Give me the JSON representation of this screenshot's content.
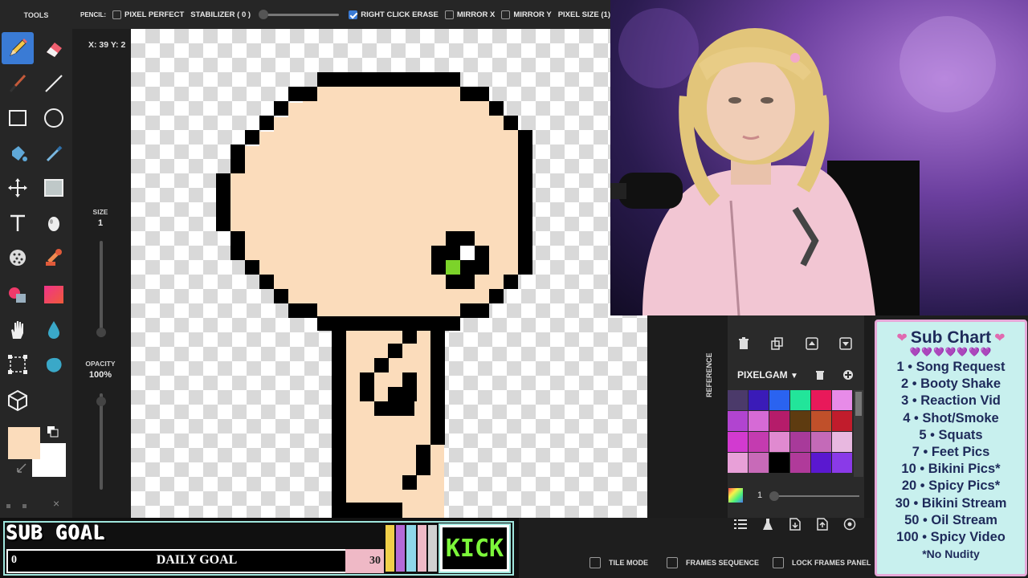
{
  "toolbar": {
    "tool_name": "PENCIL:",
    "pixel_perfect": "PIXEL PERFECT",
    "stabilizer": "STABILIZER ( 0 )",
    "right_click_erase": "RIGHT CLICK ERASE",
    "mirror_x": "MIRROR X",
    "mirror_y": "MIRROR Y",
    "pixel_size": "PIXEL SIZE (1)"
  },
  "tools": {
    "title": "TOOLS",
    "icons": [
      "pencil-icon",
      "eraser-icon",
      "brush-icon",
      "line-icon",
      "rectangle-icon",
      "ellipse-icon",
      "bucket-fill-icon",
      "eyedropper-icon",
      "move-icon",
      "select-rect-icon",
      "text-icon",
      "shading-icon",
      "dither-icon",
      "stamp-icon",
      "color-replace-icon",
      "gradient-icon",
      "hand-icon",
      "blur-icon",
      "crop-icon",
      "blob-icon",
      "3d-cube-icon"
    ],
    "fg_color": "#fbdcbb",
    "bg_color": "#ffffff"
  },
  "status": {
    "coords": "X: 39 Y: 2",
    "size_label": "SIZE",
    "size_value": "1",
    "opacity_label": "OPACITY",
    "opacity_value": "100%"
  },
  "palette": {
    "reference_label": "REFERENCE",
    "name": "PIXELGAM",
    "colors": [
      "#4b3a6a",
      "#3a1bb8",
      "#2a63f0",
      "#22e59a",
      "#e8195a",
      "#e78be8",
      "#b144d0",
      "#d66ad6",
      "#b51c6a",
      "#5e3b10",
      "#c0502a",
      "#c11c2c",
      "#d23ad0",
      "#c43bb0",
      "#e08ad0",
      "#a83a9a",
      "#c46ab8",
      "#e8b8e0",
      "#e8a0d8",
      "#c86ab8",
      "#000000",
      "#b03a9a",
      "#5a18d0",
      "#8a3ae8"
    ],
    "brush_size": "1"
  },
  "bottom": {
    "tile_mode": "TILE MODE",
    "frames_sequence": "FRAMES SEQUENCE",
    "lock_frames_panel": "LOCK FRAMES PANEL"
  },
  "sub_goal": {
    "title": "SUB GOAL",
    "current": "0",
    "label": "DAILY GOAL",
    "target": "30",
    "platform": "KICK",
    "stripe_colors": [
      "#f1d04a",
      "#b46ad8",
      "#8ed8e8",
      "#efb9c6",
      "#d0d0d0"
    ]
  },
  "sub_chart": {
    "title": "Sub Chart",
    "hearts": "💜💜💜💜💜💜💜",
    "items": [
      "1 • Song Request",
      "2 • Booty Shake",
      "3 • Reaction Vid",
      "4 • Shot/Smoke",
      "5 • Squats",
      "7 • Feet Pics",
      "10 • Bikini Pics*",
      "20 • Spicy Pics*",
      "30 • Bikini Stream",
      "50 • Oil Stream",
      "100 • Spicy Video"
    ],
    "footer": "*No Nudity"
  },
  "drawing": {
    "skin_color": "#fbdcbb",
    "outline_color": "#000000",
    "eye_color": "#7cd32a"
  }
}
